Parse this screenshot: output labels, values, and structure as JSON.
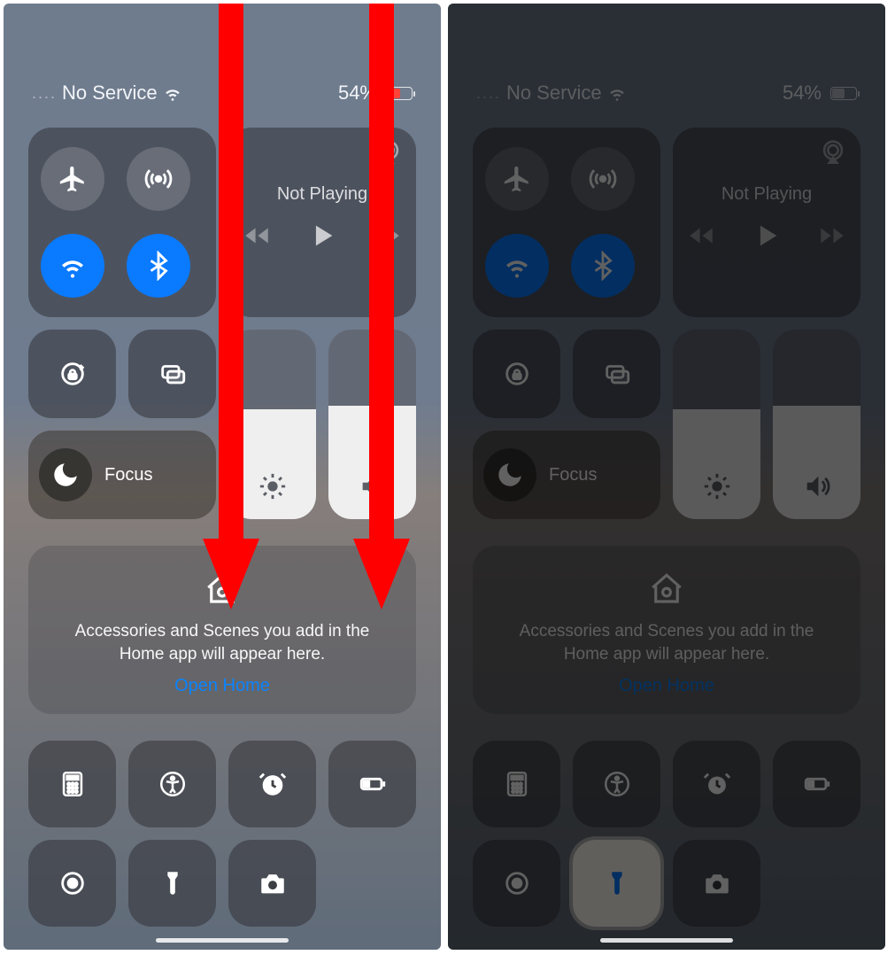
{
  "status": {
    "signal_dots": "....",
    "carrier": "No Service",
    "battery_pct": "54%"
  },
  "connectivity": {
    "airplane": {
      "on": false
    },
    "cellular": {
      "on": false
    },
    "wifi": {
      "on": true
    },
    "bluetooth": {
      "on": true
    }
  },
  "media": {
    "title": "Not Playing"
  },
  "focus": {
    "label": "Focus"
  },
  "sliders": {
    "brightness_pct": 58,
    "volume_pct": 60
  },
  "home": {
    "message_l1": "Accessories and Scenes you add in the",
    "message_l2": "Home app will appear here.",
    "link": "Open Home"
  },
  "shortcuts_row1": [
    "calculator",
    "accessibility",
    "alarm",
    "low-power"
  ],
  "shortcuts_row2": [
    "screen-record",
    "flashlight",
    "camera"
  ],
  "right_panel": {
    "flashlight_on": true
  }
}
